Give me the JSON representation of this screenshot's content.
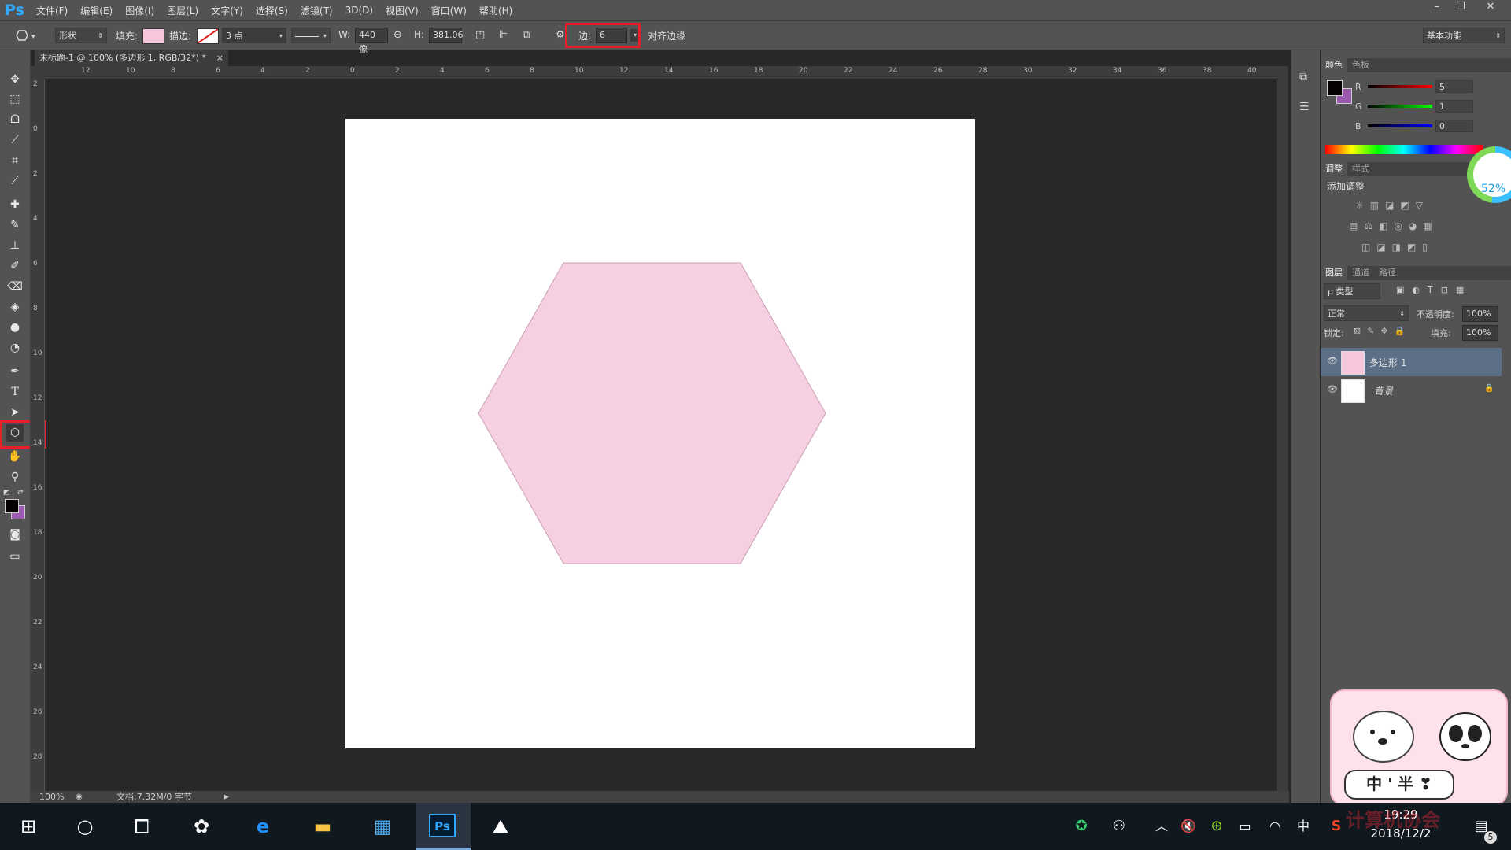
{
  "app": {
    "logo": "Ps"
  },
  "menu": [
    "文件(F)",
    "编辑(E)",
    "图像(I)",
    "图层(L)",
    "文字(Y)",
    "选择(S)",
    "滤镜(T)",
    "3D(D)",
    "视图(V)",
    "窗口(W)",
    "帮助(H)"
  ],
  "window_controls": {
    "minimize": "–",
    "restore": "❐",
    "close": "✕"
  },
  "options": {
    "shape_mode": "形状",
    "fill_label": "填充:",
    "stroke_label": "描边:",
    "stroke_width": "3 点",
    "w_label": "W:",
    "w_value": "440 像",
    "h_label": "H:",
    "h_value": "381.06",
    "sides_label": "边:",
    "sides_value": "6",
    "align_edges": "对齐边缘",
    "workspace": "基本功能",
    "fill_color": "#f7c6dd"
  },
  "document": {
    "tab_title": "未标题-1 @ 100% (多边形 1, RGB/32*) *",
    "tab_close": "×"
  },
  "ruler_top": [
    "12",
    "10",
    "8",
    "6",
    "4",
    "2",
    "0",
    "2",
    "4",
    "6",
    "8",
    "10",
    "12",
    "14",
    "16",
    "18",
    "20",
    "22",
    "24",
    "26",
    "28",
    "30",
    "32",
    "34",
    "36",
    "38",
    "40"
  ],
  "ruler_left": [
    "2",
    "0",
    "2",
    "4",
    "6",
    "8",
    "10",
    "12",
    "14",
    "16",
    "18",
    "20",
    "22",
    "24",
    "26",
    "28"
  ],
  "status": {
    "zoom": "100%",
    "doc_info": "文档:7.32M/0 字节"
  },
  "color_panel": {
    "tabs": [
      "颜色",
      "色板"
    ],
    "channels": [
      {
        "label": "R",
        "value": "5"
      },
      {
        "label": "G",
        "value": "1"
      },
      {
        "label": "B",
        "value": "0"
      }
    ],
    "fg_color": "#050100",
    "bg_color": "#9a5ab0"
  },
  "adjust_panel": {
    "tabs": [
      "调整",
      "样式"
    ],
    "title": "添加调整"
  },
  "gauge": {
    "value": "52%"
  },
  "layers_panel": {
    "tabs": [
      "图层",
      "通道",
      "路径"
    ],
    "filter": "ρ 类型",
    "blend_mode": "正常",
    "opacity_label": "不透明度:",
    "opacity": "100%",
    "lock_label": "锁定:",
    "fill_label": "填充:",
    "fill": "100%",
    "layers": [
      {
        "name": "多边形 1",
        "selected": true
      },
      {
        "name": "背景",
        "selected": false
      }
    ]
  },
  "sticker": {
    "text": "中 ' 半 ❣"
  },
  "taskbar": {
    "time": "19:29",
    "date": "2018/12/2",
    "ime": "中",
    "notification_count": "5",
    "watermark": "计算机协会"
  }
}
